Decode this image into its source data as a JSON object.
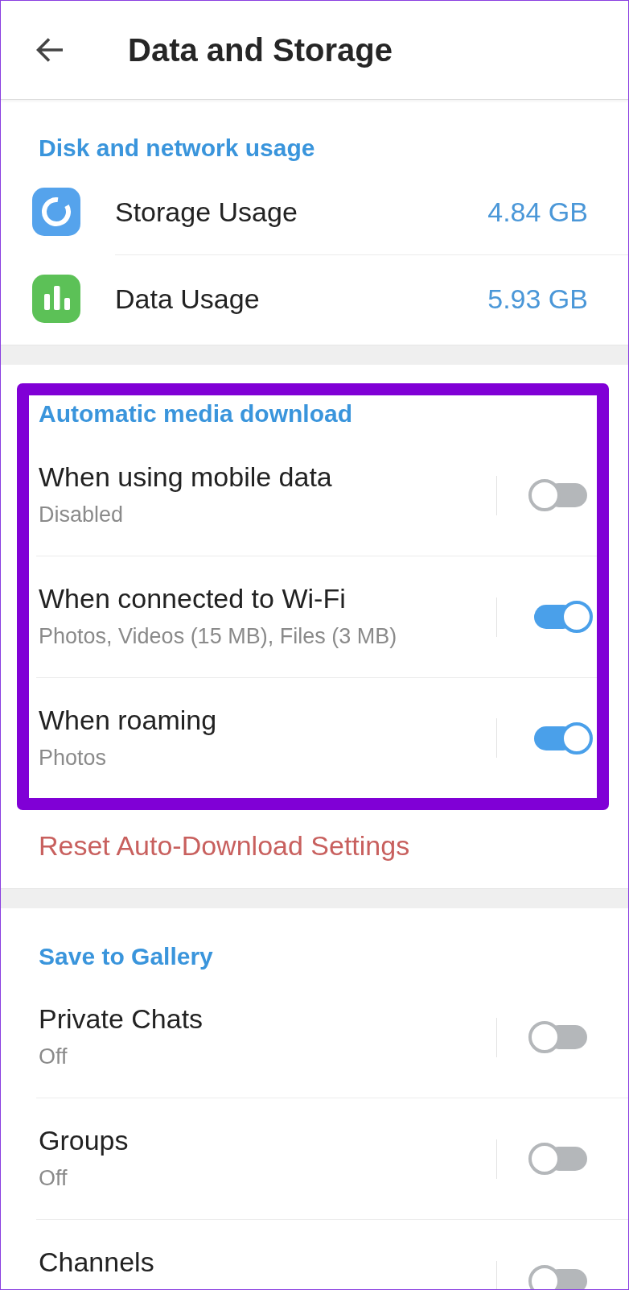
{
  "header": {
    "title": "Data and Storage"
  },
  "sections": [
    {
      "title": "Disk and network usage",
      "highlighted": false,
      "items": [
        {
          "kind": "storage",
          "label": "Storage Usage",
          "value": "4.84 GB"
        },
        {
          "kind": "data",
          "label": "Data Usage",
          "value": "5.93 GB"
        }
      ]
    },
    {
      "title": "Automatic media download",
      "highlighted": true,
      "items": [
        {
          "kind": "toggle",
          "label": "When using mobile data",
          "detail": "Disabled",
          "on": false
        },
        {
          "kind": "toggle",
          "label": "When connected to Wi-Fi",
          "detail": "Photos, Videos (15 MB), Files (3 MB)",
          "on": true
        },
        {
          "kind": "toggle",
          "label": "When roaming",
          "detail": "Photos",
          "on": true
        }
      ],
      "action": "Reset Auto-Download Settings"
    },
    {
      "title": "Save to Gallery",
      "highlighted": false,
      "items": [
        {
          "kind": "toggle",
          "label": "Private Chats",
          "detail": "Off",
          "on": false
        },
        {
          "kind": "toggle",
          "label": "Groups",
          "detail": "Off",
          "on": false
        },
        {
          "kind": "toggle",
          "label": "Channels",
          "on": false
        }
      ]
    }
  ]
}
